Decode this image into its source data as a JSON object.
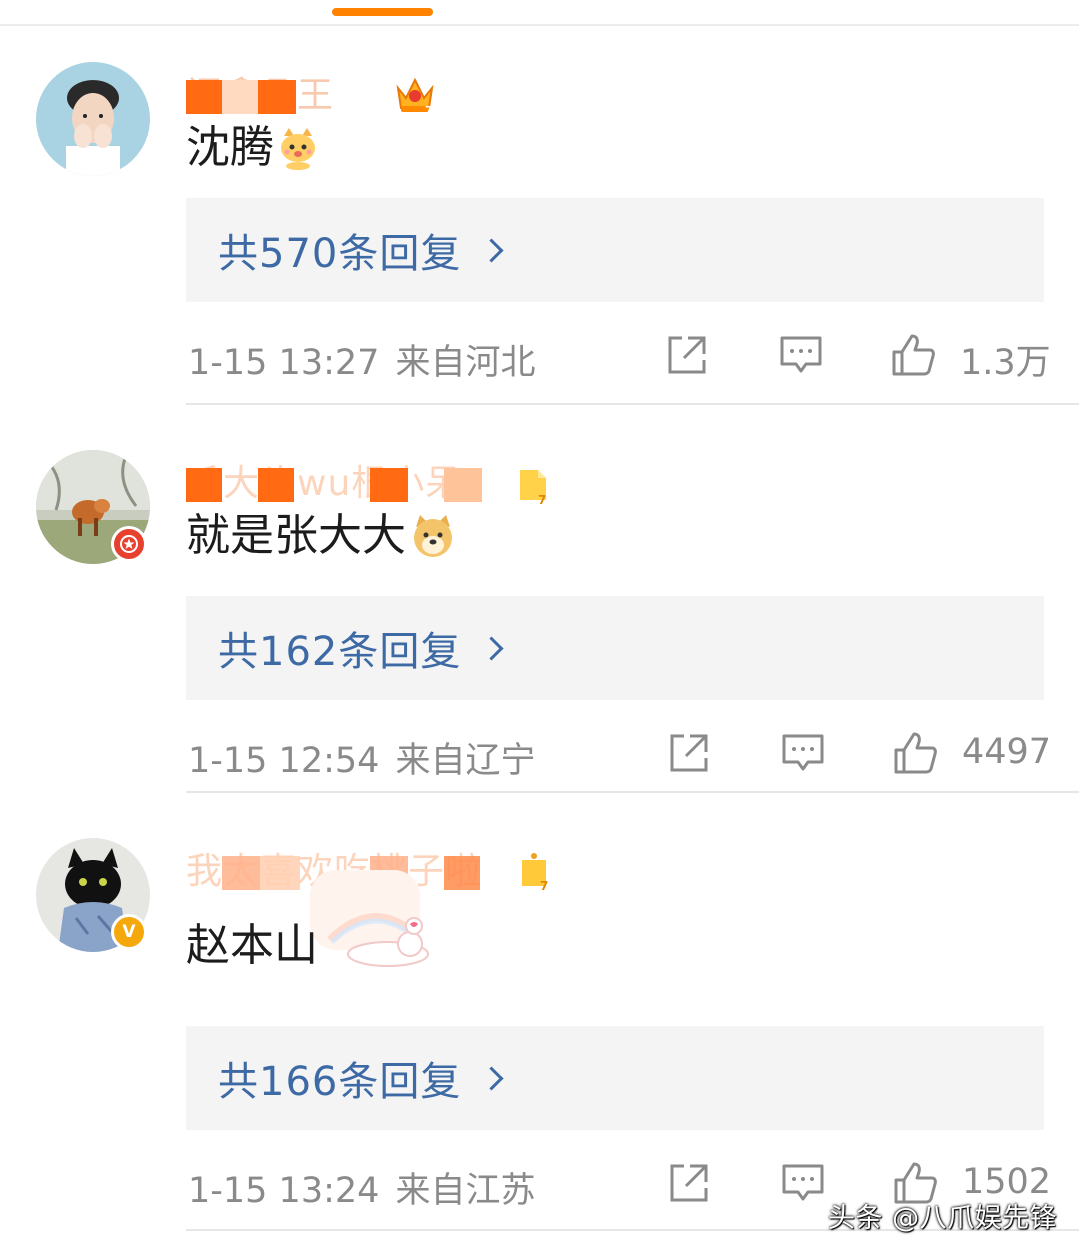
{
  "colors": {
    "accent": "#ff8200",
    "reply_link": "#3d6aa5",
    "meta_text": "#8a8a8a",
    "reply_bg": "#f4f4f4"
  },
  "comments": [
    {
      "username": "阎鑫凡王",
      "text": "沈腾",
      "emoji": "cat-emoji",
      "level_icon": "crown-level-7-icon",
      "avatar_badge": "",
      "replies_label": "共570条回复",
      "time": "1-15 13:27",
      "location": "来自河北",
      "likes": "1.3万"
    },
    {
      "username": "毛大头wu根小呆",
      "text": "就是张大大",
      "emoji": "doge-emoji",
      "level_icon": "level-7-icon",
      "avatar_badge": "red-star",
      "replies_label": "共162条回复",
      "time": "1-15 12:54",
      "location": "来自辽宁",
      "likes": "4497"
    },
    {
      "username": "我太喜欢吃桃子啦",
      "text": "赵本山",
      "emoji": "",
      "level_icon": "level-7-icon",
      "avatar_badge": "gold-v",
      "replies_label": "共166条回复",
      "time": "1-15 13:24",
      "location": "来自江苏",
      "likes": "1502"
    }
  ],
  "watermark": "头条 @八爪娱先锋"
}
